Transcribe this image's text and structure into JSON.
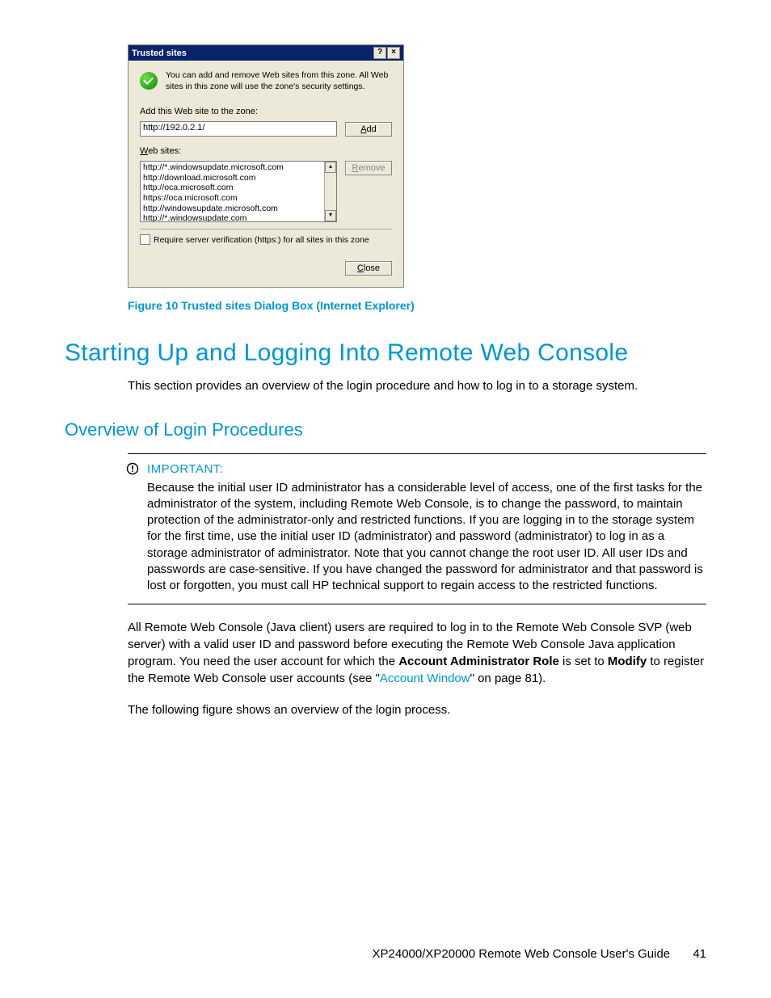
{
  "dialog": {
    "title": "Trusted sites",
    "help_btn": "?",
    "close_btn": "×",
    "info_text": "You can add and remove Web sites from this zone. All Web sites in this zone will use the zone's security settings.",
    "add_label": "Add this Web site to the zone:",
    "add_value": "http://192.0.2.1/",
    "add_btn_pre": "",
    "add_btn_accel": "A",
    "add_btn_post": "dd",
    "websites_label_pre": "",
    "websites_label_accel": "W",
    "websites_label_post": "eb sites:",
    "sites": [
      "http://*.windowsupdate.microsoft.com",
      "http://download.microsoft.com",
      "http://oca.microsoft.com",
      "https://oca.microsoft.com",
      "http://windowsupdate.microsoft.com",
      "http://*.windowsupdate.com"
    ],
    "remove_btn_pre": "",
    "remove_btn_accel": "R",
    "remove_btn_post": "emove",
    "require_label": "Require server verification (https:) for all sites in this zone",
    "close_dlg_pre": "",
    "close_dlg_accel": "C",
    "close_dlg_post": "lose"
  },
  "caption": "Figure 10 Trusted sites Dialog Box (Internet Explorer)",
  "h1": "Starting Up and Logging Into Remote Web Console",
  "intro": "This section provides an overview of the login procedure and how to log in to a storage system.",
  "h2": "Overview of Login Procedures",
  "important_label": "IMPORTANT:",
  "important_text": "Because the initial user ID administrator has a considerable level of access, one of the first tasks for the administrator of the system, including Remote Web Console, is to change the password, to maintain protection of the administrator-only and restricted functions. If you are logging in to the storage system for the first time, use the initial user ID (administrator) and password (administrator) to log in as a storage administrator of administrator. Note that you cannot change the root user ID. All user IDs and passwords are case-sensitive. If you have changed the password for administrator and that password is lost or forgotten, you must call HP technical support to regain access to the restricted functions.",
  "para1_a": "All Remote Web Console (Java client) users are required to log in to the Remote Web Console SVP (web server) with a valid user ID and password before executing the Remote Web Console Java application program. You need the user account for which the ",
  "para1_bold1": "Account Administrator Role",
  "para1_b": " is set to ",
  "para1_bold2": "Modify",
  "para1_c": " to register the Remote Web Console user accounts (see \"",
  "para1_link": "Account Window",
  "para1_d": "\" on page 81).",
  "para2": "The following figure shows an overview of the login process.",
  "footer_text": "XP24000/XP20000 Remote Web Console User's Guide",
  "footer_page": "41"
}
